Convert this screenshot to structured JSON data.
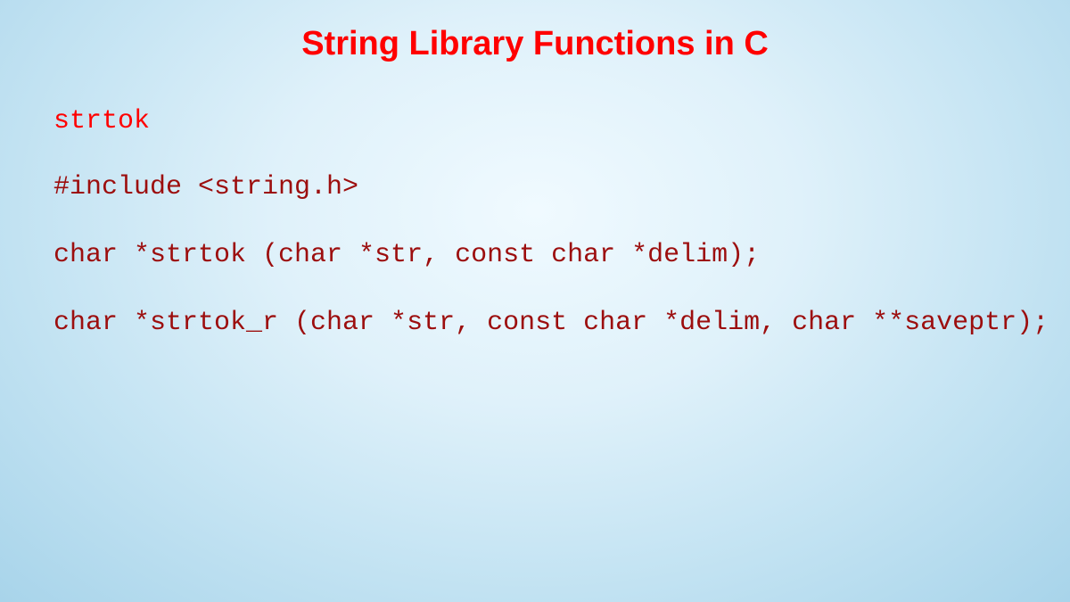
{
  "title": "String Library Functions in C",
  "function_name": "strtok",
  "code_lines": {
    "include": "#include <string.h>",
    "prototype1": "char *strtok (char *str, const char *delim);",
    "prototype2": "char *strtok_r (char *str, const char *delim, char **saveptr);"
  }
}
